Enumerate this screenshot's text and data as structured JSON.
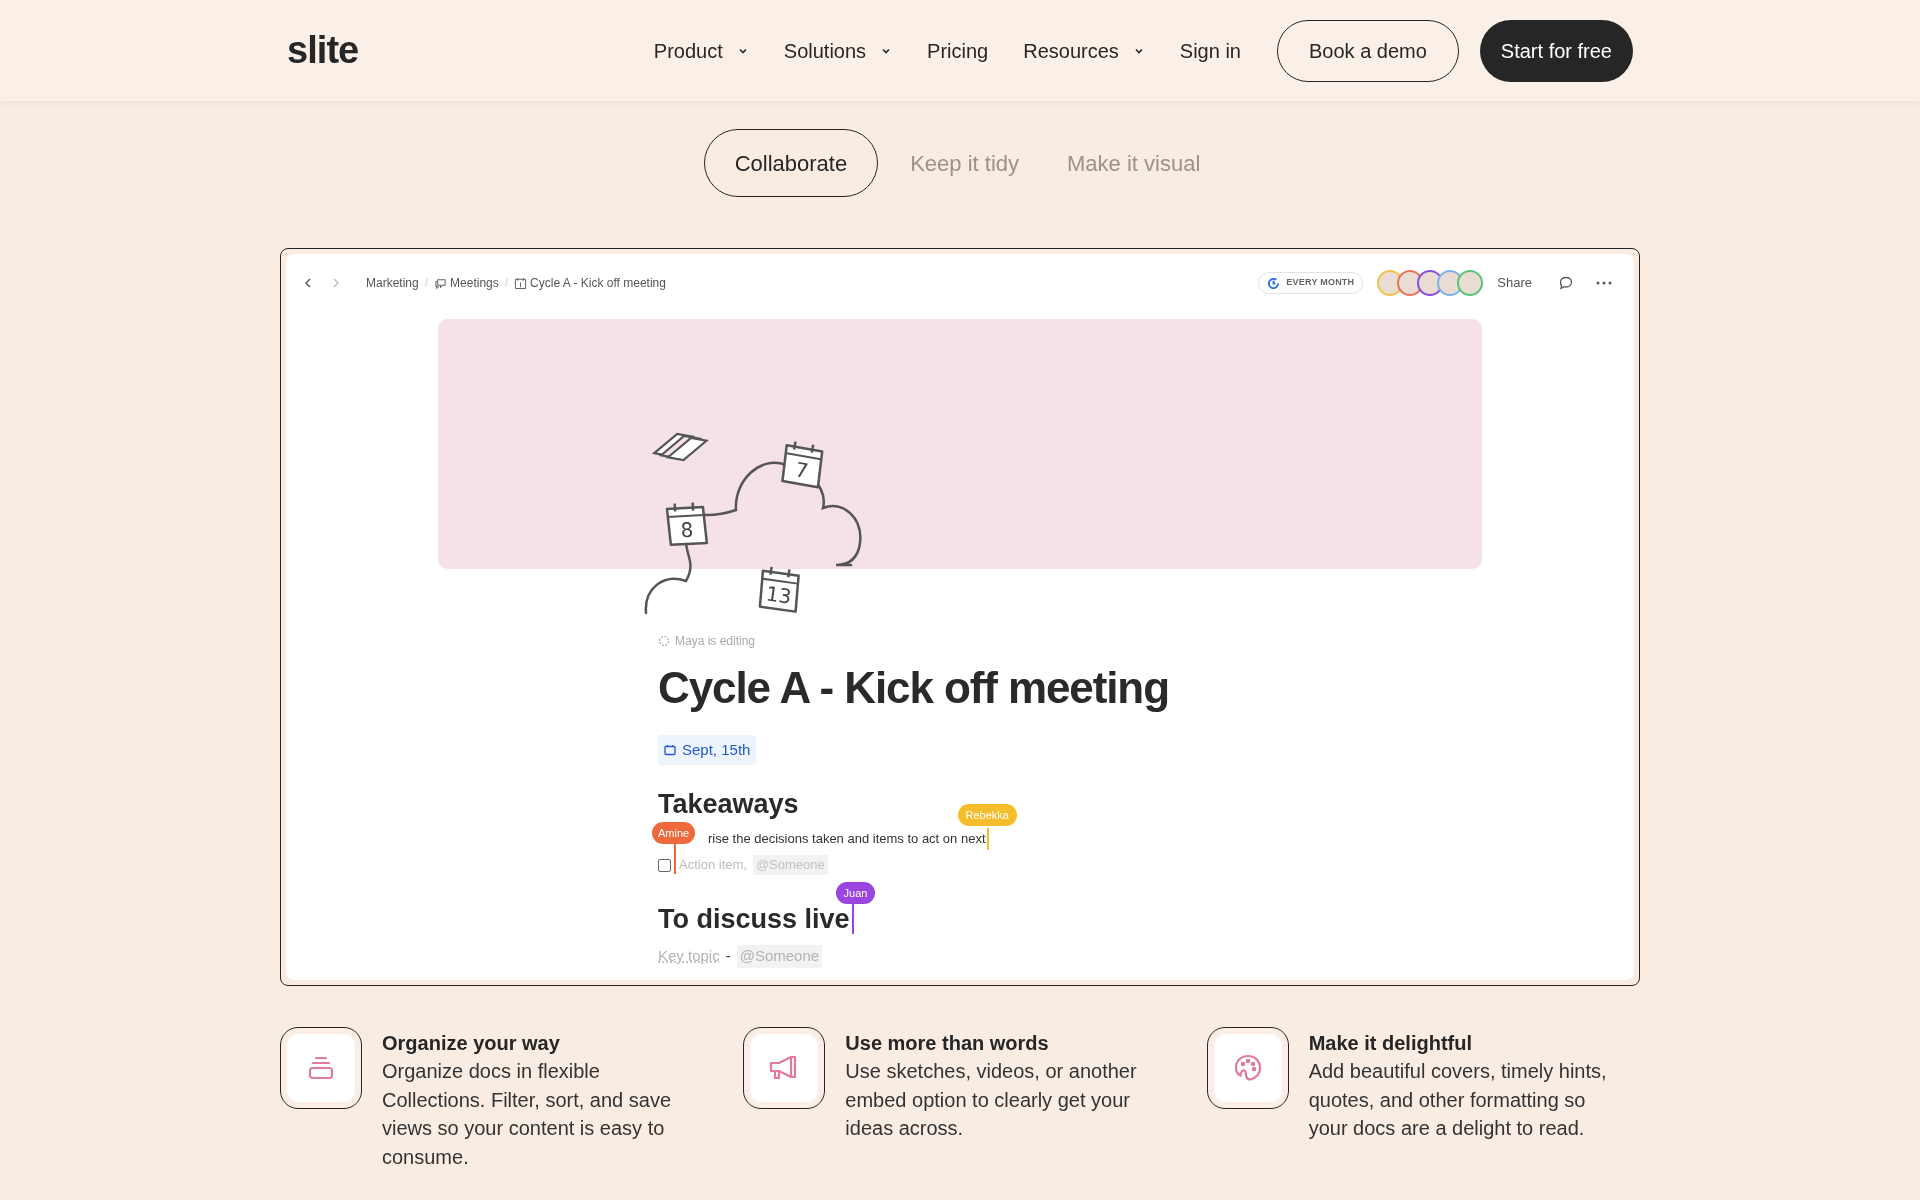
{
  "nav": {
    "logo": "slite",
    "items": [
      {
        "label": "Product",
        "dropdown": true
      },
      {
        "label": "Solutions",
        "dropdown": true
      },
      {
        "label": "Pricing",
        "dropdown": false
      },
      {
        "label": "Resources",
        "dropdown": true
      },
      {
        "label": "Sign in",
        "dropdown": false
      }
    ],
    "demo_button": "Book a demo",
    "start_button": "Start for free"
  },
  "tabs": [
    {
      "label": "Collaborate",
      "selected": true
    },
    {
      "label": "Keep it tidy",
      "selected": false
    },
    {
      "label": "Make it visual",
      "selected": false
    }
  ],
  "doc": {
    "breadcrumb": [
      {
        "label": "Marketing",
        "kind": "plain"
      },
      {
        "label": "Meetings",
        "kind": "chat"
      },
      {
        "label": "Cycle A - Kick off meeting",
        "kind": "calendar"
      }
    ],
    "breadcrumb_separators": [
      "/",
      "/"
    ],
    "recurrence": "EVERY MONTH",
    "avatars": [
      {
        "color": "#f2c14e"
      },
      {
        "color": "#e8735a"
      },
      {
        "color": "#8b4fd8"
      },
      {
        "color": "#7fb2e5"
      },
      {
        "color": "#5cc47a"
      }
    ],
    "share": "Share",
    "cover": {
      "calendar_numbers": [
        "7",
        "8",
        "13"
      ]
    },
    "status": "Maya is editing",
    "title": "Cycle A - Kick off meeting",
    "date": "Sept, 15th",
    "takeaways_heading": "Takeaways",
    "takeaways_text": "rise the decisions taken and items to act on next",
    "action_item": {
      "text": "Action item,",
      "mention": "@Someone",
      "checked": false
    },
    "discuss_heading": "To discuss live",
    "key_topic": "Key topic",
    "key_topic_sep": "-",
    "key_mention": "@Someone",
    "cursors": [
      {
        "name": "Amine",
        "color": "#ee6a3c"
      },
      {
        "name": "Rebekka",
        "color": "#f5bd2b"
      },
      {
        "name": "Juan",
        "color": "#9b45e0"
      }
    ]
  },
  "features": [
    {
      "kind": "stack",
      "title": "Organize your way",
      "text": "Organize docs in flexible Collections. Filter, sort, and save views so your content is easy to consume."
    },
    {
      "kind": "megaphone",
      "title": "Use more than words",
      "text": "Use sketches, videos, or another embed option to clearly get your ideas across."
    },
    {
      "kind": "palette",
      "title": "Make it delightful",
      "text": "Add beautiful covers, timely hints, quotes, and other formatting so your docs are a delight to read."
    }
  ]
}
